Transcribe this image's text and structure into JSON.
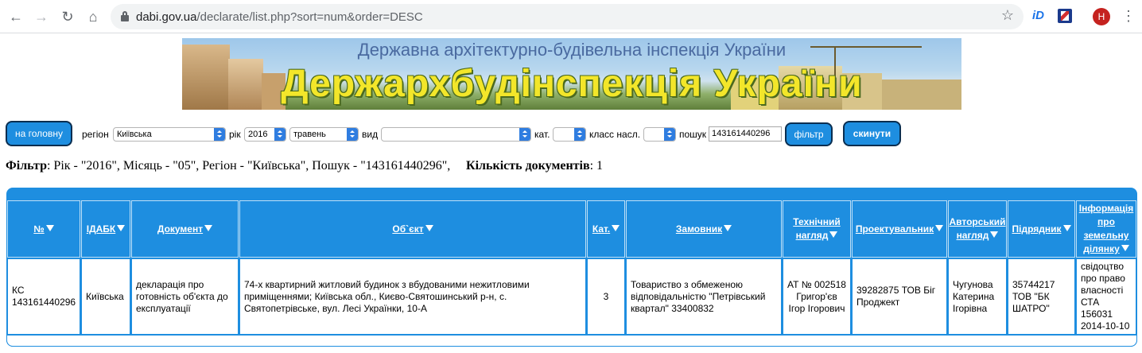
{
  "browser": {
    "url_host": "dabi.gov.ua",
    "url_path": "/declarate/list.php?sort=num&order=DESC",
    "ext1_label": "iD",
    "avatar_letter": "H"
  },
  "banner": {
    "subtitle": "Державна архітектурно-будівельна інспекція України",
    "title": "Держархбудінспекція України"
  },
  "toolbar": {
    "home_label": "на головну",
    "region_label": "регіон",
    "region_value": "Київська",
    "year_label": "рік",
    "year_value": "2016",
    "month_value": "травень",
    "type_label": "вид",
    "type_value": "",
    "cat_label": "кат.",
    "cat_value": "",
    "class_label": "класс насл.",
    "class_value": "",
    "search_label": "пошук",
    "search_value": "143161440296",
    "filter_label": "фільтр",
    "reset_label": "скинути"
  },
  "summary": {
    "filter_label": "Фільтр",
    "filter_text": ": Рік - \"2016\", Місяць - \"05\", Регіон - \"Київська\", Пошук - \"143161440296\",",
    "count_label": "Кількість документів",
    "count_value": ": 1"
  },
  "table": {
    "headers": [
      "№",
      "ІДАБК",
      "Документ",
      "Об`єкт",
      "Кат.",
      "Замовник",
      "Технічний нагляд",
      "Проектувальник",
      "Авторський нагляд",
      "Підрядник",
      "Інформація про земельну ділянку"
    ],
    "rows": [
      [
        "КС 143161440296",
        "Київська",
        "декларація про готовність об'єкта до експлуатації",
        "74-х квартирний житловий будинок з вбудованими нежитловими приміщеннями; Київська обл., Києво-Святошинський р-н, с. Святопетрівське, вул. Лесі Українки, 10-А",
        "3",
        "Товариство з обмеженою відповідальністю \"Петрівський квартал\" 33400832",
        "АТ № 002518 Григор'єв Ігор Ігорович",
        "39282875 ТОВ Біг Проджект",
        "Чугунова Катерина Ігорівна",
        "35744217 ТОВ \"БК ШАТРО\"",
        "свідоцтво про право власності СТА 156031 2014-10-10"
      ]
    ]
  }
}
